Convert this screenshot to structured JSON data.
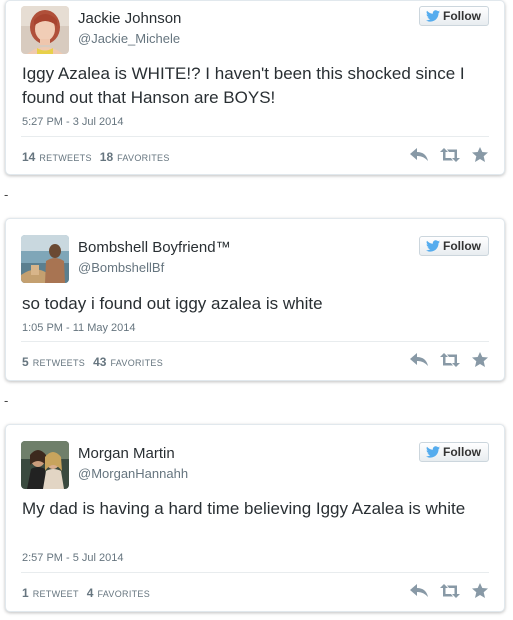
{
  "follow_label": "Follow",
  "colors": {
    "twitter_blue": "#55acee",
    "text": "#292f33",
    "muted": "#66757f",
    "action_icon": "#8899a6"
  },
  "separator": "-",
  "tweets": [
    {
      "name": "Jackie Johnson",
      "handle": "@Jackie_Michele",
      "text": "Iggy Azalea is WHITE!? I haven't been this shocked since I found out that Hanson are BOYS!",
      "timestamp": "5:27 PM - 3 Jul 2014",
      "retweets": "14",
      "retweets_label": "RETWEETS",
      "favorites": "18",
      "favorites_label": "FAVORITES",
      "avatar_icon": "user-photo-icon"
    },
    {
      "name": "Bombshell Boyfriend™",
      "handle": "@BombshellBf",
      "text": "so today i found out iggy azalea is white",
      "timestamp": "1:05 PM - 11 May 2014",
      "retweets": "5",
      "retweets_label": "RETWEETS",
      "favorites": "43",
      "favorites_label": "FAVORITES",
      "avatar_icon": "user-photo-icon"
    },
    {
      "name": "Morgan Martin",
      "handle": "@MorganHannahh",
      "text": "My dad is having a hard time believing Iggy Azalea is white",
      "timestamp": "2:57 PM - 5 Jul 2014",
      "retweets": "1",
      "retweets_label": "RETWEET",
      "favorites": "4",
      "favorites_label": "FAVORITES",
      "avatar_icon": "user-photo-icon"
    }
  ],
  "action_icons": [
    "reply-icon",
    "retweet-icon",
    "favorite-icon"
  ]
}
